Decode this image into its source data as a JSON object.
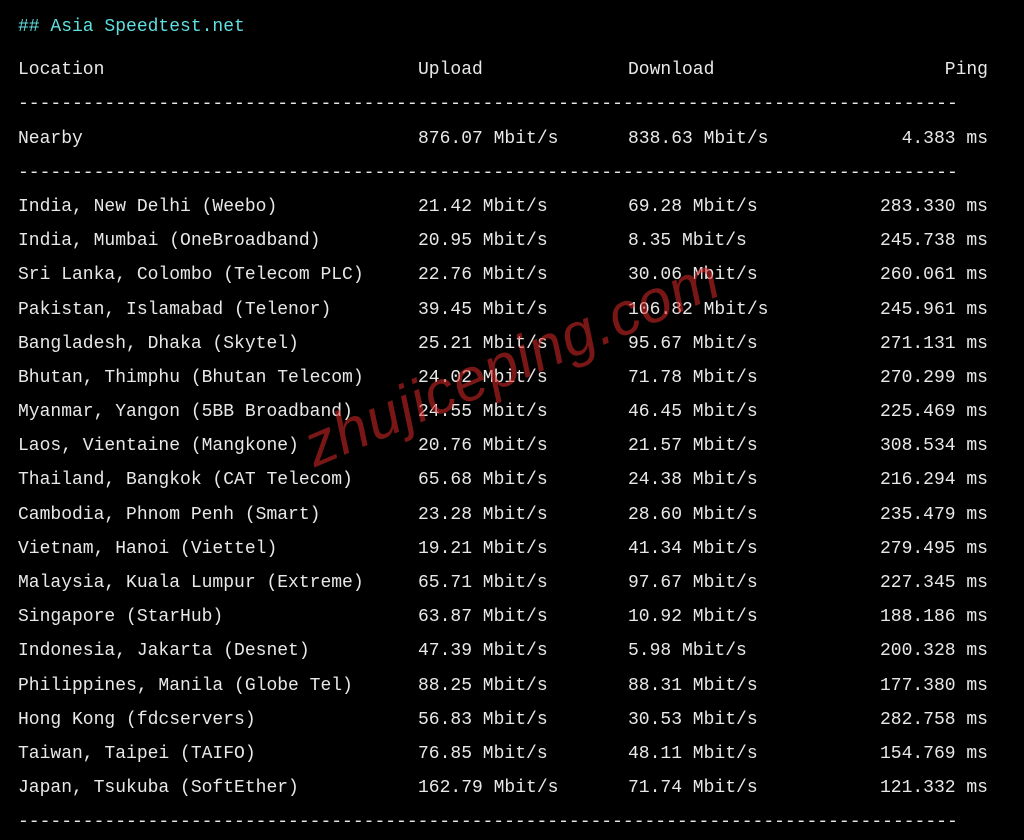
{
  "title": "## Asia Speedtest.net",
  "watermark": "zhujiceping.com",
  "dashline": "---------------------------------------------------------------------------------------",
  "headers": {
    "location": "Location",
    "upload": "Upload",
    "download": "Download",
    "ping": " Ping"
  },
  "unit_speed": " Mbit/s",
  "unit_ping": " ms",
  "nearby": {
    "location": "Nearby",
    "upload": "876.07",
    "download": "838.63",
    "ping": "4.383"
  },
  "rows": [
    {
      "location": "India, New Delhi (Weebo)",
      "upload": "21.42",
      "download": "69.28",
      "ping": "283.330"
    },
    {
      "location": "India, Mumbai (OneBroadband)",
      "upload": "20.95",
      "download": "8.35",
      "ping": "245.738"
    },
    {
      "location": "Sri Lanka, Colombo (Telecom PLC)",
      "upload": "22.76",
      "download": "30.06",
      "ping": "260.061"
    },
    {
      "location": "Pakistan, Islamabad (Telenor)",
      "upload": "39.45",
      "download": "106.82",
      "ping": "245.961"
    },
    {
      "location": "Bangladesh, Dhaka (Skytel)",
      "upload": "25.21",
      "download": "95.67",
      "ping": "271.131"
    },
    {
      "location": "Bhutan, Thimphu (Bhutan Telecom)",
      "upload": "24.02",
      "download": "71.78",
      "ping": "270.299"
    },
    {
      "location": "Myanmar, Yangon (5BB Broadband)",
      "upload": "24.55",
      "download": "46.45",
      "ping": "225.469"
    },
    {
      "location": "Laos, Vientaine (Mangkone)",
      "upload": "20.76",
      "download": "21.57",
      "ping": "308.534"
    },
    {
      "location": "Thailand, Bangkok (CAT Telecom)",
      "upload": "65.68",
      "download": "24.38",
      "ping": "216.294"
    },
    {
      "location": "Cambodia, Phnom Penh (Smart)",
      "upload": "23.28",
      "download": "28.60",
      "ping": "235.479"
    },
    {
      "location": "Vietnam, Hanoi (Viettel)",
      "upload": "19.21",
      "download": "41.34",
      "ping": "279.495"
    },
    {
      "location": "Malaysia, Kuala Lumpur (Extreme)",
      "upload": "65.71",
      "download": "97.67",
      "ping": "227.345"
    },
    {
      "location": "Singapore (StarHub)",
      "upload": "63.87",
      "download": "10.92",
      "ping": "188.186"
    },
    {
      "location": "Indonesia, Jakarta (Desnet)",
      "upload": "47.39",
      "download": "5.98",
      "ping": "200.328"
    },
    {
      "location": "Philippines, Manila (Globe Tel)",
      "upload": "88.25",
      "download": "88.31",
      "ping": "177.380"
    },
    {
      "location": "Hong Kong (fdcservers)",
      "upload": "56.83",
      "download": "30.53",
      "ping": "282.758"
    },
    {
      "location": "Taiwan, Taipei (TAIFO)",
      "upload": "76.85",
      "download": "48.11",
      "ping": "154.769"
    },
    {
      "location": "Japan, Tsukuba (SoftEther)",
      "upload": "162.79",
      "download": "71.74",
      "ping": "121.332"
    }
  ]
}
